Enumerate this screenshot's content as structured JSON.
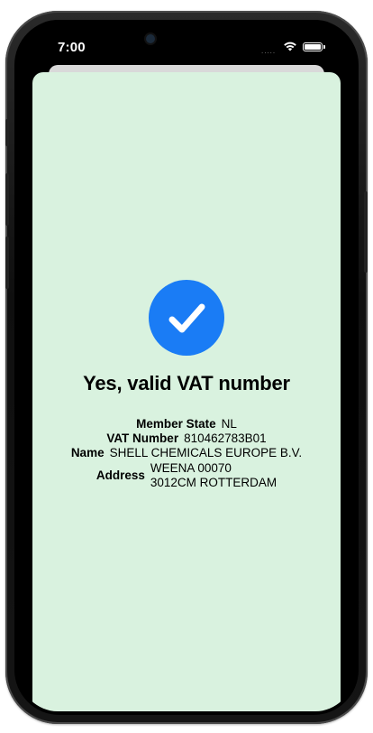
{
  "status_bar": {
    "time": "7:00",
    "signal": ".....",
    "wifi_icon": "wifi-icon",
    "battery_icon": "battery-icon"
  },
  "result": {
    "icon": "checkmark-circle-icon",
    "icon_color": "#1a7cf5",
    "background_color": "#d9f2df",
    "title": "Yes, valid VAT number"
  },
  "details": {
    "member_state": {
      "label": "Member State",
      "value": "NL"
    },
    "vat_number": {
      "label": "VAT Number",
      "value": "810462783B01"
    },
    "name": {
      "label": "Name",
      "value": "SHELL CHEMICALS EUROPE B.V."
    },
    "address": {
      "label": "Address",
      "lines": [
        "WEENA 00070",
        "3012CM ROTTERDAM"
      ]
    }
  }
}
